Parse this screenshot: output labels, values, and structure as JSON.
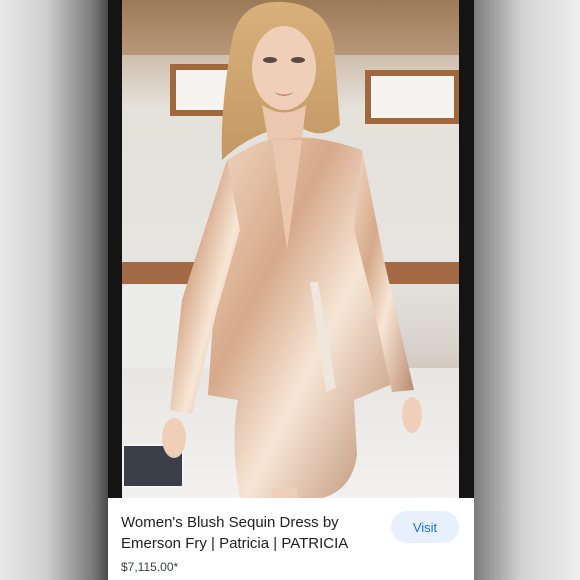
{
  "product": {
    "title": "Women's Blush Sequin Dress by Emerson Fry | Patricia | PATRICIA",
    "price": "$7,115.00*",
    "visit_label": "Visit"
  },
  "colors": {
    "visit_bg": "#e8f0fe",
    "visit_text": "#1a73e8",
    "sequin": "#d9b39a"
  },
  "icons": {
    "product_image": "product-photo"
  }
}
